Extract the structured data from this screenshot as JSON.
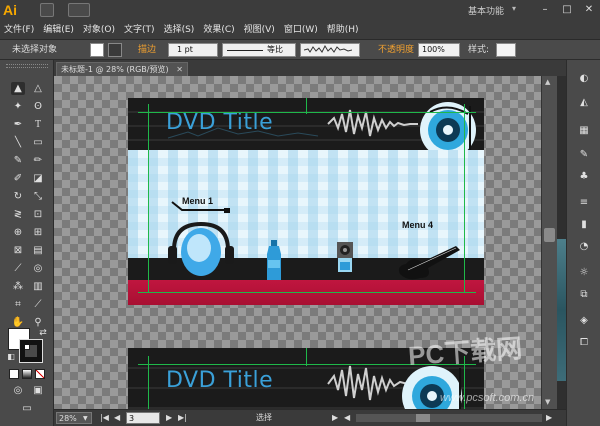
{
  "app": {
    "logo": "Ai",
    "workspace": "基本功能",
    "workspace_arrow": "▾"
  },
  "window_controls": {
    "minimize": "–",
    "maximize": "□",
    "close": "✕"
  },
  "menu": [
    "文件(F)",
    "编辑(E)",
    "对象(O)",
    "文字(T)",
    "选择(S)",
    "效果(C)",
    "视图(V)",
    "窗口(W)",
    "帮助(H)"
  ],
  "control_bar": {
    "selection_status": "未选择对象",
    "stroke_label": "描边",
    "stroke_weight": "1 pt",
    "stroke_profile": "等比",
    "opacity_label": "不透明度",
    "opacity_value": "100%",
    "style_label": "样式:"
  },
  "document": {
    "tab_title": "未标题-1 @ 28% (RGB/预览)",
    "tab_close": "✕"
  },
  "artboard": {
    "title": "DVD Title",
    "menu1": "Menu 1",
    "menu4": "Menu 4"
  },
  "status_bar": {
    "zoom": "28%",
    "artboard_number": "3",
    "status_text": "选择"
  },
  "watermark": {
    "text": "PC下载网",
    "url": "www.pcsoft.com.cn"
  },
  "colors": {
    "accent": "#f7a800",
    "title_blue": "#3aa0d8",
    "guide_green": "#1fb84a",
    "red_band": "#c0163f"
  },
  "tools": [
    "selection-tool",
    "direct-selection-tool",
    "magic-wand-tool",
    "lasso-tool",
    "pen-tool",
    "type-tool",
    "line-tool",
    "rectangle-tool",
    "paintbrush-tool",
    "pencil-tool",
    "blob-brush-tool",
    "eraser-tool",
    "rotate-tool",
    "scale-tool",
    "width-tool",
    "free-transform-tool",
    "shape-builder-tool",
    "perspective-grid-tool",
    "mesh-tool",
    "gradient-tool",
    "eyedropper-tool",
    "blend-tool",
    "symbol-sprayer-tool",
    "column-graph-tool",
    "artboard-tool",
    "slice-tool",
    "hand-tool",
    "zoom-tool"
  ]
}
